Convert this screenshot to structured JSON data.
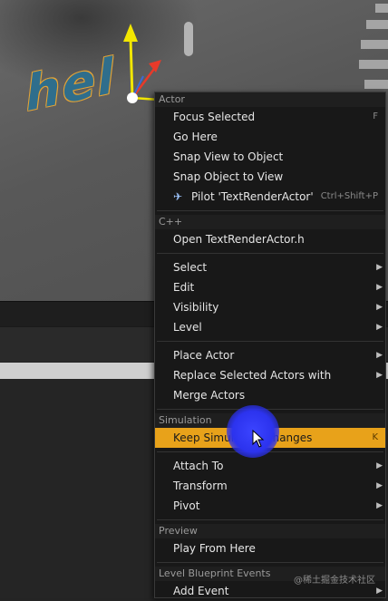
{
  "viewport": {
    "text_actor": "hel"
  },
  "menu": {
    "sections": {
      "actor": "Actor",
      "cpp": "C++",
      "simulation": "Simulation",
      "preview": "Preview",
      "level_blueprint": "Level Blueprint Events"
    },
    "items": {
      "focus_selected": "Focus Selected",
      "focus_shortcut": "F",
      "go_here": "Go Here",
      "snap_view": "Snap View to Object",
      "snap_object": "Snap Object to View",
      "pilot": "Pilot 'TextRenderActor'",
      "pilot_shortcut": "Ctrl+Shift+P",
      "open_header": "Open TextRenderActor.h",
      "select": "Select",
      "edit": "Edit",
      "visibility": "Visibility",
      "level": "Level",
      "place_actor": "Place Actor",
      "replace_actors": "Replace Selected Actors with",
      "merge_actors": "Merge Actors",
      "keep_sim": "Keep Simulation Changes",
      "keep_sim_shortcut": "K",
      "attach_to": "Attach To",
      "transform": "Transform",
      "pivot": "Pivot",
      "play_from_here": "Play From Here",
      "add_event": "Add Event"
    },
    "icons": {
      "submenu_arrow": "▶",
      "pilot_icon": "airplane-icon"
    }
  },
  "watermark": "@稀土掘金技术社区",
  "colors": {
    "highlight": "#e8a21a",
    "menu_bg": "#181818",
    "cursor_halo": "#2c33ee"
  }
}
